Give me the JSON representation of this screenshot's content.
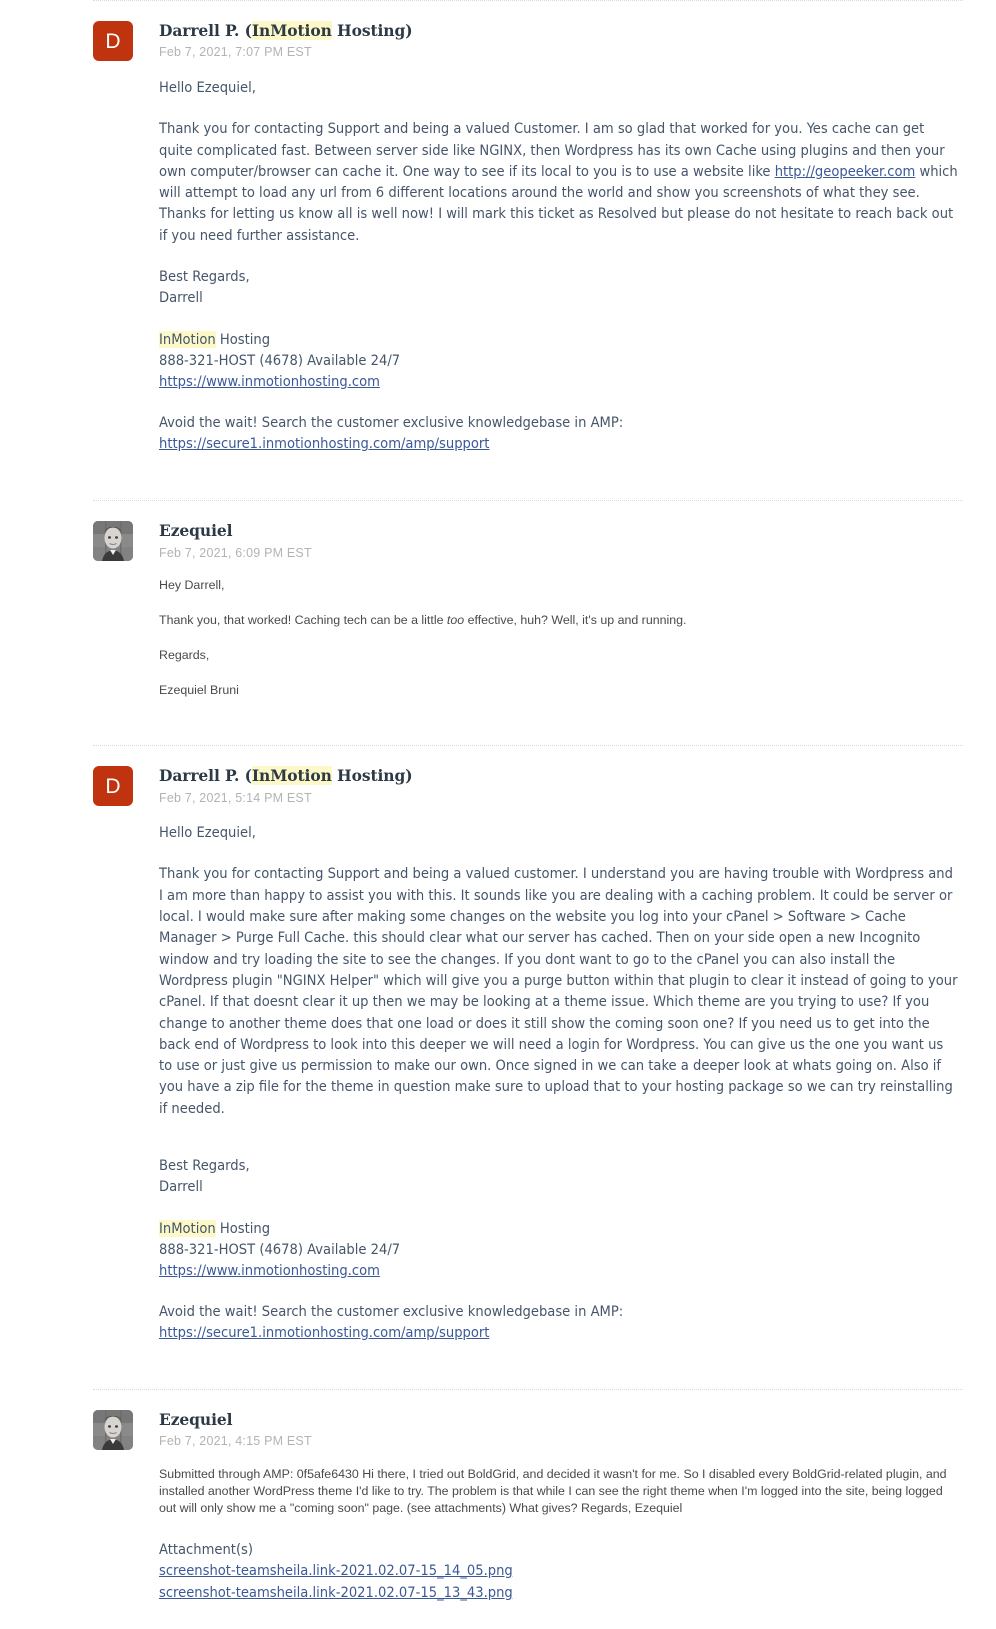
{
  "thread": {
    "messages": [
      {
        "id": "msg-1",
        "author_type": "agent",
        "avatar": {
          "type": "initial",
          "initial": "D",
          "color": "#c0330f"
        },
        "author_prefix": "Darrell P. (",
        "author_highlight": "InMotion",
        "author_suffix": " Hosting)",
        "date": "Feb 7, 2021, 7:07 PM EST",
        "greeting": "Hello Ezequiel,",
        "paragraph_before_link": "  Thank you for contacting Support and being a valued Customer. I am so glad that worked for you. Yes cache can get quite complicated fast. Between server side like NGINX, then Wordpress has its own Cache using plugins and then your own computer/browser can cache it. One way to see if its local to you is to use a website like ",
        "inline_link": "http://geopeeker.com",
        "paragraph_after_link": " which will attempt to load any url from 6 different locations around the world and show you screenshots of what they see. Thanks for letting us know all is well now! I will mark this ticket as Resolved but please do not hesitate to reach back out if you need further assistance.",
        "closing_1": "Best Regards,",
        "closing_2": "Darrell",
        "company_highlight": "InMotion",
        "company_rest": " Hosting",
        "phone_line": "888-321-HOST (4678) Available 24/7",
        "site_link": "https://www.inmotionhosting.com",
        "amp_text": "Avoid the wait! Search the customer exclusive knowledgebase in AMP:",
        "amp_link": "https://secure1.inmotionhosting.com/amp/support"
      },
      {
        "id": "msg-2",
        "author_type": "customer",
        "avatar": {
          "type": "photo"
        },
        "author_name": "Ezequiel",
        "date": "Feb 7, 2021, 6:09 PM EST",
        "line_1": "Hey Darrell,",
        "line_2_a": "Thank you, that worked! Caching tech can be a little ",
        "line_2_em": "too",
        "line_2_b": " effective, huh? Well, it's up and running.",
        "line_3": "Regards,",
        "line_4": "Ezequiel Bruni"
      },
      {
        "id": "msg-3",
        "author_type": "agent",
        "avatar": {
          "type": "initial",
          "initial": "D",
          "color": "#c0330f"
        },
        "author_prefix": "Darrell P. (",
        "author_highlight": "InMotion",
        "author_suffix": " Hosting)",
        "date": "Feb 7, 2021, 5:14 PM EST",
        "greeting": "Hello Ezequiel,",
        "body_paragraph": "  Thank you for contacting Support and being a valued customer. I understand you are having trouble with Wordpress and I am more than happy to assist you with this. It sounds like you are dealing with a caching problem. It could be server or local. I would make sure after making some changes on the website you log into your cPanel > Software > Cache Manager > Purge Full Cache. this should clear what our server has cached. Then on your side open a new Incognito window and try loading the site to see the changes. If you dont want to go to the cPanel you can also install the Wordpress plugin \"NGINX Helper\" which will give you a purge button within that plugin to clear it instead of going to your cPanel. If that doesnt clear it up then we may be looking at a theme issue. Which theme are you trying to use? If you change to another theme does that one load or does it still show the coming soon one? If you need us to get into the back end of Wordpress to look into this deeper we will need a login for Wordpress. You can give us the one you want us to use or just give us permission to make our own. Once signed in we can take a deeper look at whats going on. Also if you have a zip file for the theme in question make sure to upload that to your hosting package so we can try reinstalling if needed.",
        "closing_1": "Best Regards,",
        "closing_2": "Darrell",
        "company_highlight": "InMotion",
        "company_rest": " Hosting",
        "phone_line": "888-321-HOST (4678) Available 24/7",
        "site_link": "https://www.inmotionhosting.com",
        "amp_text": "Avoid the wait! Search the customer exclusive knowledgebase in AMP:",
        "amp_link": "https://secure1.inmotionhosting.com/amp/support"
      },
      {
        "id": "msg-4",
        "author_type": "customer",
        "avatar": {
          "type": "photo"
        },
        "author_name": "Ezequiel",
        "date": "Feb 7, 2021, 4:15 PM EST",
        "body": "Submitted through AMP: 0f5afe6430 Hi there, I tried out BoldGrid, and decided it wasn't for me. So I disabled every BoldGrid-related plugin, and installed another WordPress theme I'd like to try. The problem is that while I can see the right theme when I'm logged into the site, being logged out will only show me a \"coming soon\" page. (see attachments) What gives? Regards, Ezequiel",
        "attachments_label": "Attachment(s)",
        "attachments": [
          "screenshot-teamsheila.link-2021.02.07-15_14_05.png",
          "screenshot-teamsheila.link-2021.02.07-15_13_43.png"
        ]
      }
    ]
  },
  "colors": {
    "avatar_red": "#c0330f",
    "link_blue": "#3b5998",
    "highlight_yellow": "#fcf8c8",
    "body_text": "#46566a",
    "date_gray": "#b3b3b3",
    "separator": "#d9d9d9"
  }
}
